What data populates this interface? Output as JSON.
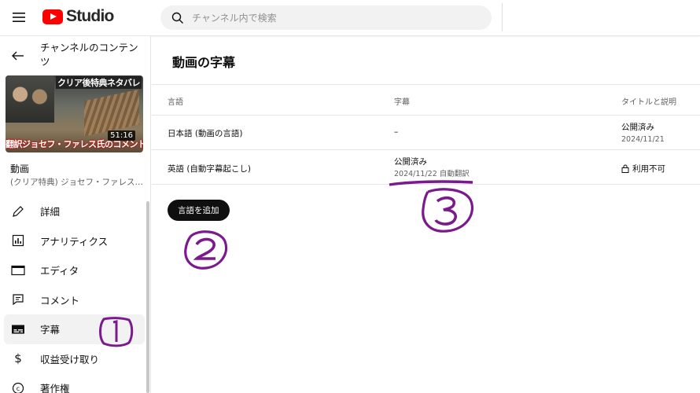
{
  "header": {
    "logo_text": "Studio",
    "search_placeholder": "チャンネル内で検索"
  },
  "sidebar": {
    "channel_content_title": "チャンネルのコンテンツ",
    "thumbnail": {
      "caption_top": "クリア後特典ネタバレ",
      "caption_bottom": "翻訳ジョセフ・ファレス氏のコメント",
      "duration": "51:16"
    },
    "video_label": "動画",
    "video_title": "(クリア特典) ジョセフ・ファレス氏...",
    "nav": [
      {
        "label": "詳細",
        "icon": "pencil-icon"
      },
      {
        "label": "アナリティクス",
        "icon": "analytics-icon"
      },
      {
        "label": "エディタ",
        "icon": "editor-icon"
      },
      {
        "label": "コメント",
        "icon": "comment-icon"
      },
      {
        "label": "字幕",
        "icon": "subtitles-icon",
        "active": true
      },
      {
        "label": "収益受け取り",
        "icon": "dollar-icon"
      },
      {
        "label": "著作権",
        "icon": "copyright-icon"
      }
    ]
  },
  "main": {
    "title": "動画の字幕",
    "columns": [
      "言語",
      "字幕",
      "タイトルと説明"
    ],
    "rows": [
      {
        "language": "日本語 (動画の言語)",
        "subtitles": "–",
        "title_status": "公開済み",
        "title_date": "2024/11/21"
      },
      {
        "language": "英語 (自動字幕起こし)",
        "subtitles_status": "公開済み",
        "subtitles_date": "2024/11/22 自動翻訳",
        "title_status": "利用不可"
      }
    ],
    "add_language_button": "言語を追加"
  },
  "annotations": {
    "color": "#7a1a8c",
    "marks": [
      "1",
      "2",
      "3"
    ]
  }
}
